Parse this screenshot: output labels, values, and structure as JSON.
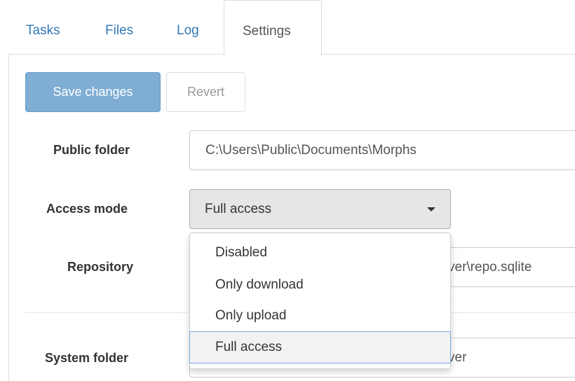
{
  "tabs": [
    {
      "label": "Tasks",
      "active": false
    },
    {
      "label": "Files",
      "active": false
    },
    {
      "label": "Log",
      "active": false
    },
    {
      "label": "Settings",
      "active": true
    }
  ],
  "toolbar": {
    "save_label": "Save changes",
    "revert_label": "Revert"
  },
  "form": {
    "public_folder": {
      "label": "Public folder",
      "value": "C:\\Users\\Public\\Documents\\Morphs"
    },
    "access_mode": {
      "label": "Access mode",
      "value": "Full access",
      "options": [
        "Disabled",
        "Only download",
        "Only upload",
        "Full access"
      ],
      "selected_index": 3
    },
    "repository": {
      "label": "Repository",
      "value_visible_suffix": "ver\\repo.sqlite"
    },
    "system_folder": {
      "label": "System folder",
      "value_visible_suffix": "ver"
    }
  },
  "colors": {
    "link": "#337ab7",
    "primary_disabled": "#7fadd4",
    "selected_outline": "#7aa7e0"
  }
}
